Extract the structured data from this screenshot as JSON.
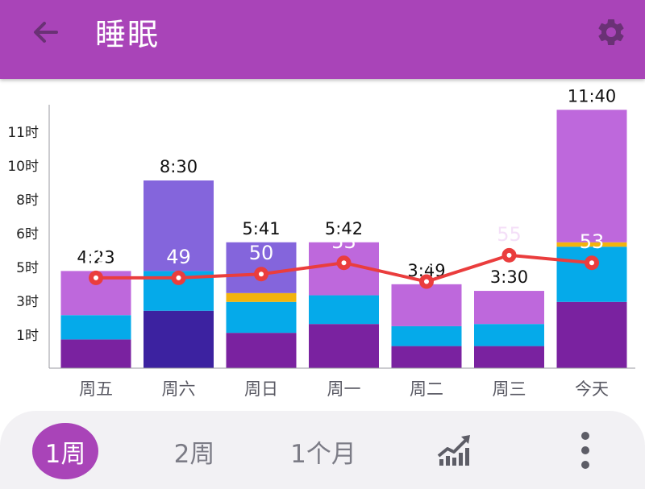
{
  "header": {
    "title": "睡眠",
    "back_icon": "arrow-left-icon",
    "settings_icon": "gear-icon"
  },
  "colors": {
    "appbar": "#a944b8",
    "deep": "#7a22a0",
    "deep_dark": "#3c22a0",
    "light": "#05aaea",
    "rem": "#be68dc",
    "rem_alt": "#8465dc",
    "awake": "#f2b30e",
    "score_line": "#ea3d3d"
  },
  "chart_data": {
    "type": "bar",
    "stacked": true,
    "unit": "小时",
    "categories": [
      "周五",
      "周六",
      "周日",
      "周一",
      "周二",
      "周三",
      "今天"
    ],
    "duration_labels": [
      "4:23",
      "8:30",
      "5:41",
      "5:42",
      "3:49",
      "3:30",
      "11:40"
    ],
    "y_ticks": [
      "1时",
      "3时",
      "5时",
      "6时",
      "8时",
      "10时",
      "11时"
    ],
    "ylim": [
      0,
      12
    ],
    "series": [
      {
        "values": [
          1.3,
          2.6,
          1.6,
          2.0,
          1.0,
          1.0,
          3.0
        ]
      },
      {
        "values": [
          1.1,
          1.8,
          1.4,
          1.3,
          0.9,
          1.0,
          2.5
        ]
      },
      {
        "values": [
          0.0,
          0.0,
          0.4,
          0.0,
          0.0,
          0.0,
          0.2
        ]
      },
      {
        "values": [
          2.0,
          4.1,
          2.3,
          2.4,
          1.9,
          1.5,
          6.0
        ]
      }
    ],
    "scores": [
      49,
      49,
      50,
      53,
      48,
      55,
      53
    ],
    "score_range": [
      25,
      95
    ],
    "grid": false,
    "legend": "none"
  },
  "footer": {
    "tabs": [
      {
        "label": "1周",
        "active": true
      },
      {
        "label": "2周",
        "active": false
      },
      {
        "label": "1个月",
        "active": false
      }
    ],
    "trend_icon": "trend-chart-icon",
    "more_icon": "more-vertical-icon"
  }
}
